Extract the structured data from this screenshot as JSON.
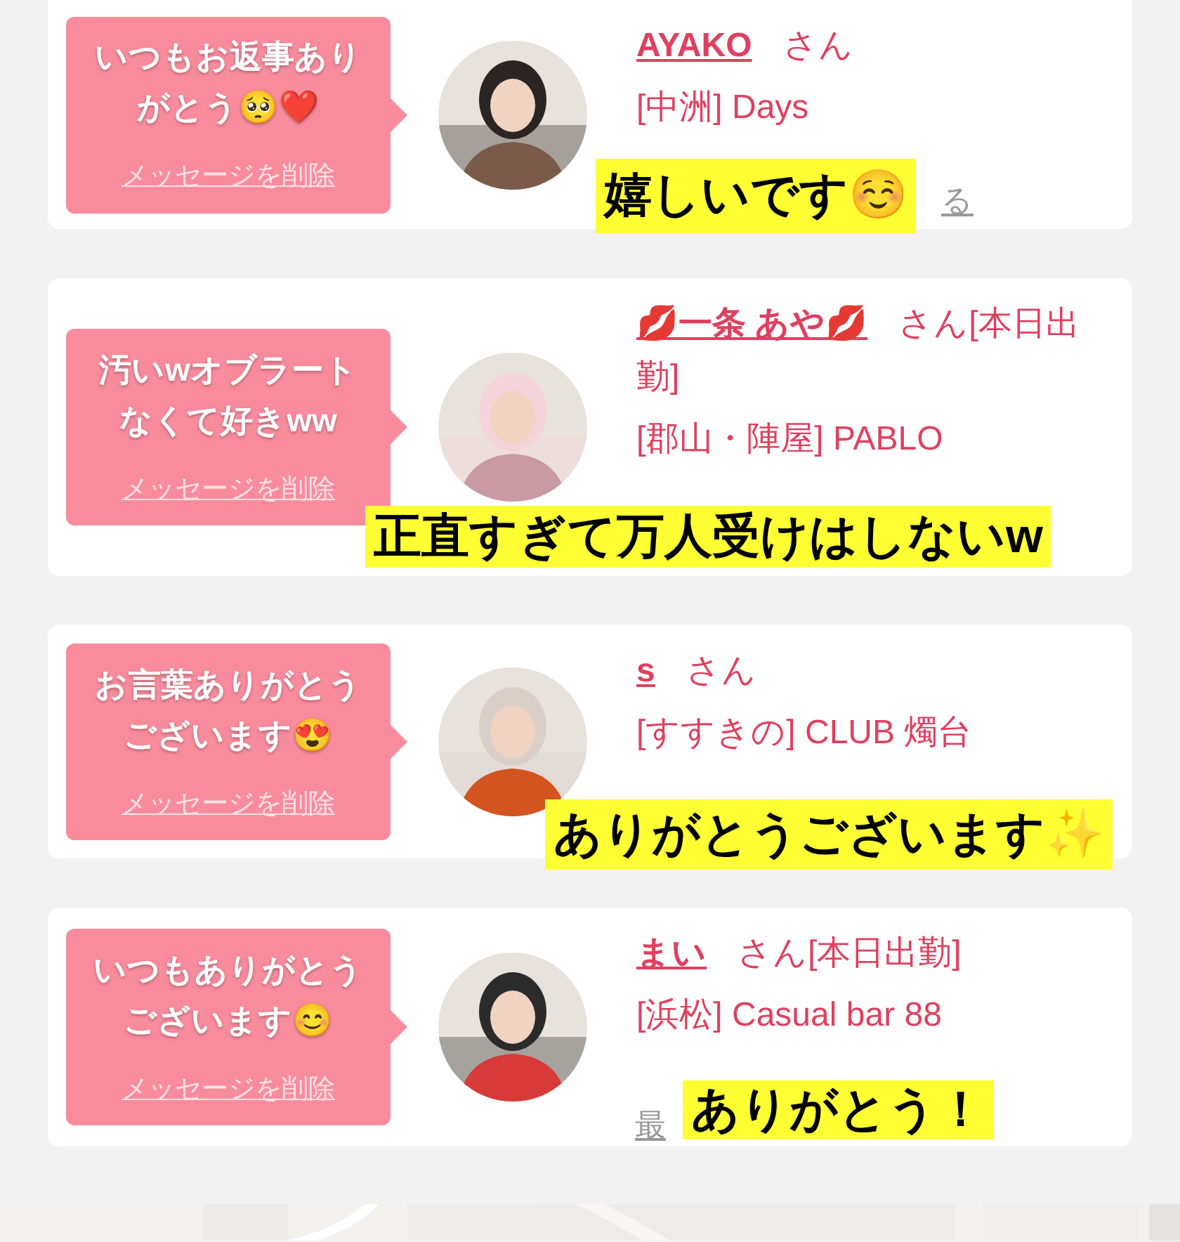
{
  "cards": [
    {
      "message": "いつもお返事ありがとう🥺❤️",
      "delete_link": "メッセージを削除",
      "name": "AYAKO",
      "suffix": "さん",
      "shop": "[中洲] Days",
      "link_fragment": "る",
      "caption": "嬉しいです☺️"
    },
    {
      "message": "汚いwオブラートなくて好きww",
      "delete_link": "メッセージを削除",
      "name": "💋一条 あや💋",
      "suffix": "さん[本日出勤]",
      "shop": "[郡山・陣屋] PABLO",
      "caption": "正直すぎて万人受けはしないw"
    },
    {
      "message": "お言葉ありがとうございます😍",
      "delete_link": "メッセージを削除",
      "name": "s",
      "suffix": "さん",
      "shop": "[すすきの] CLUB 燭台",
      "caption": "ありがとうございます✨"
    },
    {
      "message": "いつもありがとうございます😊",
      "delete_link": "メッセージを削除",
      "name": "まい",
      "suffix": "さん[本日出勤]",
      "shop": "[浜松] Casual bar 88",
      "link_fragment": "最",
      "caption": "ありがとう！"
    }
  ]
}
